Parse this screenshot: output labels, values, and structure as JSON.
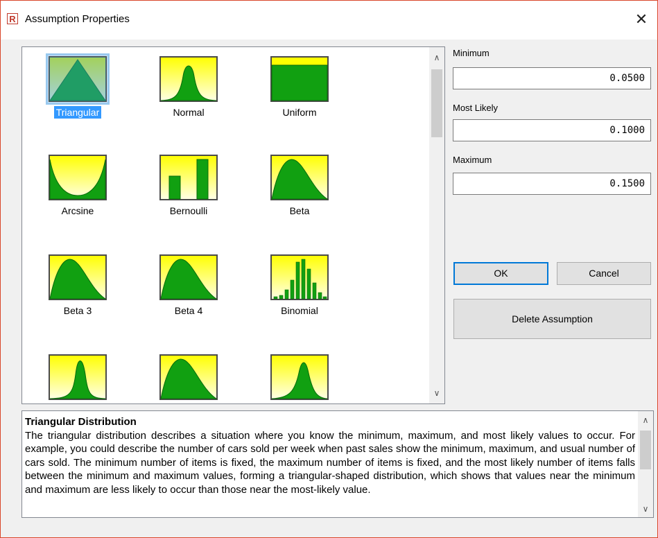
{
  "window": {
    "title": "Assumption Properties",
    "close_glyph": "✕",
    "app_icon": "R"
  },
  "gallery": {
    "items": [
      {
        "label": "Triangular",
        "icon": "triangular-distribution-icon",
        "selected": true
      },
      {
        "label": "Normal",
        "icon": "normal-distribution-icon"
      },
      {
        "label": "Uniform",
        "icon": "uniform-distribution-icon"
      },
      {
        "label": "Arcsine",
        "icon": "arcsine-distribution-icon"
      },
      {
        "label": "Bernoulli",
        "icon": "bernoulli-distribution-icon"
      },
      {
        "label": "Beta",
        "icon": "beta-distribution-icon"
      },
      {
        "label": "Beta 3",
        "icon": "beta3-distribution-icon"
      },
      {
        "label": "Beta 4",
        "icon": "beta4-distribution-icon"
      },
      {
        "label": "Binomial",
        "icon": "binomial-distribution-icon"
      },
      {
        "label": "",
        "icon": "distribution-icon"
      },
      {
        "label": "",
        "icon": "distribution-icon"
      },
      {
        "label": "",
        "icon": "distribution-icon"
      }
    ],
    "scroll_up": "∧",
    "scroll_down": "∨"
  },
  "params": {
    "minimum": {
      "label": "Minimum",
      "value": "0.0500"
    },
    "most_likely": {
      "label": "Most Likely",
      "value": "0.1000"
    },
    "maximum": {
      "label": "Maximum",
      "value": "0.1500"
    }
  },
  "buttons": {
    "ok": "OK",
    "cancel": "Cancel",
    "delete": "Delete Assumption"
  },
  "description": {
    "title": "Triangular Distribution",
    "body": "The triangular distribution describes a situation where you know the minimum, maximum, and most likely values to occur. For example, you could describe the number of cars sold per week when past sales show the minimum, maximum, and usual number of cars sold. The minimum number of items is fixed, the maximum number of items is fixed, and the most likely number of items falls between the minimum and maximum values, forming a triangular-shaped distribution, which shows that values near the minimum and maximum are less likely to occur than those near the most-likely value."
  },
  "colors": {
    "fill_green": "#11a011",
    "bg_yellow": "#ffff00",
    "select_blue": "#3399ff",
    "accent": "#0078d7"
  }
}
